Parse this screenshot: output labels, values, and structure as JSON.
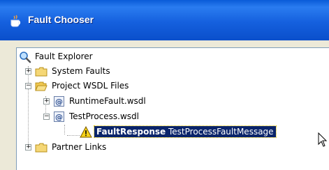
{
  "window": {
    "title": "Fault Chooser"
  },
  "tree": {
    "root_label": "Fault Explorer",
    "nodes": [
      {
        "label": "System Faults",
        "expander": "+"
      },
      {
        "label": "Project WSDL Files",
        "expander": "−"
      },
      {
        "label": "RuntimeFault.wsdl",
        "expander": "+"
      },
      {
        "label": "TestProcess.wsdl",
        "expander": "−"
      },
      {
        "label_bold": "FaultResponse",
        "label_rest": "TestProcessFaultMessage"
      },
      {
        "label": "Partner Links",
        "expander": "+"
      }
    ]
  }
}
